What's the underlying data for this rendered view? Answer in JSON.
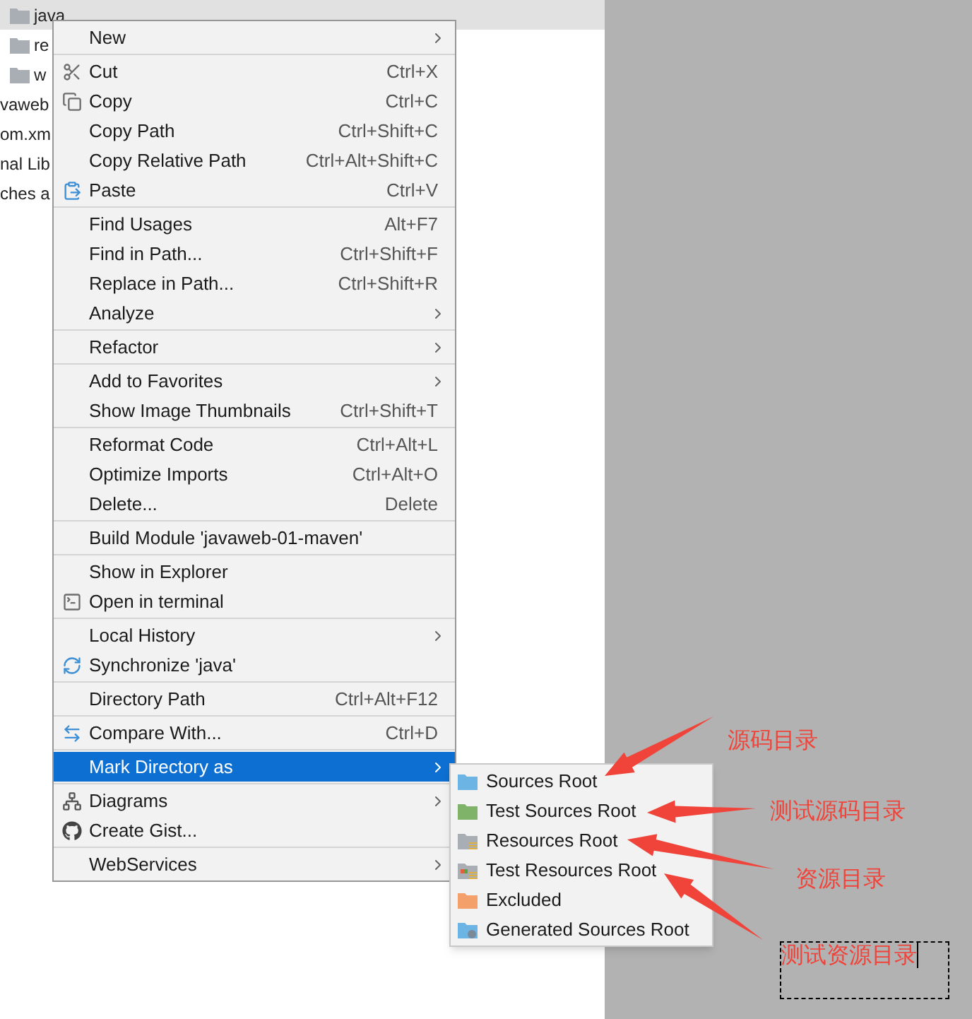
{
  "tree": {
    "rows": [
      {
        "label": "java",
        "folder": true,
        "selected": true
      },
      {
        "label": "re",
        "folder": true,
        "selected": false
      },
      {
        "label": "w",
        "folder": true,
        "selected": false
      },
      {
        "label": "vaweb",
        "folder": false,
        "selected": false
      },
      {
        "label": "om.xm",
        "folder": false,
        "selected": false
      },
      {
        "label": "nal Lib",
        "folder": false,
        "selected": false
      },
      {
        "label": "ches a",
        "folder": false,
        "selected": false
      }
    ]
  },
  "menu": {
    "groups": [
      {
        "items": [
          {
            "label": "New",
            "kind": "plain",
            "submenu": true,
            "selected": false
          }
        ]
      },
      {
        "items": [
          {
            "label": "Cut",
            "kind": "cut",
            "shortcut": "Ctrl+X",
            "submenu": false,
            "selected": false
          },
          {
            "label": "Copy",
            "kind": "copy",
            "shortcut": "Ctrl+C",
            "submenu": false,
            "selected": false
          },
          {
            "label": "Copy Path",
            "kind": "plain",
            "shortcut": "Ctrl+Shift+C",
            "submenu": false,
            "selected": false
          },
          {
            "label": "Copy Relative Path",
            "kind": "plain",
            "shortcut": "Ctrl+Alt+Shift+C",
            "submenu": false,
            "selected": false
          },
          {
            "label": "Paste",
            "kind": "paste",
            "shortcut": "Ctrl+V",
            "submenu": false,
            "selected": false
          }
        ]
      },
      {
        "items": [
          {
            "label": "Find Usages",
            "kind": "plain",
            "shortcut": "Alt+F7",
            "submenu": false,
            "selected": false
          },
          {
            "label": "Find in Path...",
            "kind": "plain",
            "shortcut": "Ctrl+Shift+F",
            "submenu": false,
            "selected": false
          },
          {
            "label": "Replace in Path...",
            "kind": "plain",
            "shortcut": "Ctrl+Shift+R",
            "submenu": false,
            "selected": false
          },
          {
            "label": "Analyze",
            "kind": "plain",
            "submenu": true,
            "selected": false
          }
        ]
      },
      {
        "items": [
          {
            "label": "Refactor",
            "kind": "plain",
            "submenu": true,
            "selected": false
          }
        ]
      },
      {
        "items": [
          {
            "label": "Add to Favorites",
            "kind": "plain",
            "submenu": true,
            "selected": false
          },
          {
            "label": "Show Image Thumbnails",
            "kind": "plain",
            "shortcut": "Ctrl+Shift+T",
            "submenu": false,
            "selected": false
          }
        ]
      },
      {
        "items": [
          {
            "label": "Reformat Code",
            "kind": "plain",
            "shortcut": "Ctrl+Alt+L",
            "submenu": false,
            "selected": false
          },
          {
            "label": "Optimize Imports",
            "kind": "plain",
            "shortcut": "Ctrl+Alt+O",
            "submenu": false,
            "selected": false
          },
          {
            "label": "Delete...",
            "kind": "plain",
            "shortcut": "Delete",
            "submenu": false,
            "selected": false
          }
        ]
      },
      {
        "items": [
          {
            "label": "Build Module 'javaweb-01-maven'",
            "kind": "plain",
            "submenu": false,
            "selected": false
          }
        ]
      },
      {
        "items": [
          {
            "label": "Show in Explorer",
            "kind": "plain",
            "submenu": false,
            "selected": false
          },
          {
            "label": "Open in terminal",
            "kind": "terminal",
            "submenu": false,
            "selected": false
          }
        ]
      },
      {
        "items": [
          {
            "label": "Local History",
            "kind": "plain",
            "submenu": true,
            "selected": false
          },
          {
            "label": "Synchronize 'java'",
            "kind": "sync",
            "submenu": false,
            "selected": false
          }
        ]
      },
      {
        "items": [
          {
            "label": "Directory Path",
            "kind": "plain",
            "shortcut": "Ctrl+Alt+F12",
            "submenu": false,
            "selected": false
          }
        ]
      },
      {
        "items": [
          {
            "label": "Compare With...",
            "kind": "compare",
            "shortcut": "Ctrl+D",
            "submenu": false,
            "selected": false
          }
        ]
      },
      {
        "items": [
          {
            "label": "Mark Directory as",
            "kind": "plain",
            "submenu": true,
            "selected": true
          }
        ]
      },
      {
        "items": [
          {
            "label": "Diagrams",
            "kind": "diagram",
            "submenu": true,
            "selected": false
          },
          {
            "label": "Create Gist...",
            "kind": "gist",
            "submenu": false,
            "selected": false
          }
        ]
      },
      {
        "items": [
          {
            "label": "WebServices",
            "kind": "plain",
            "submenu": true,
            "selected": false
          }
        ]
      }
    ]
  },
  "submenu": {
    "items": [
      {
        "label": "Sources Root",
        "kind": "folder",
        "color": "#6cb4e4"
      },
      {
        "label": "Test Sources Root",
        "kind": "folder",
        "color": "#7fb36a"
      },
      {
        "label": "Resources Root",
        "kind": "resources",
        "color": "#a9aeb4"
      },
      {
        "label": "Test Resources Root",
        "kind": "test_resources",
        "color": "#a9aeb4"
      },
      {
        "label": "Excluded",
        "kind": "folder",
        "color": "#f4a06a"
      },
      {
        "label": "Generated Sources Root",
        "kind": "generated",
        "color": "#6cb4e4"
      }
    ]
  },
  "annotations": [
    {
      "text": "源码目录",
      "editing": false
    },
    {
      "text": "测试源码目录",
      "editing": false
    },
    {
      "text": "资源目录",
      "editing": false
    },
    {
      "text": "测试资源目录",
      "editing": true
    }
  ]
}
